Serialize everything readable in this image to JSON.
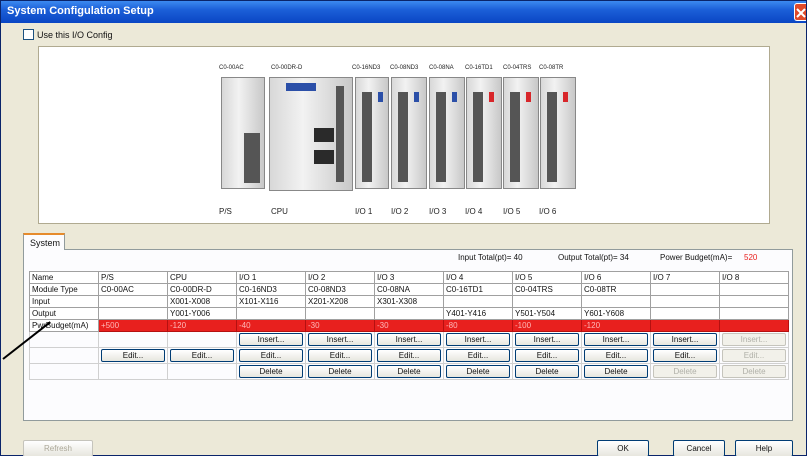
{
  "window": {
    "title": "System Configulation Setup"
  },
  "use_io_config": {
    "label": "Use this I/O Config",
    "checked": false
  },
  "hardware": {
    "module_labels": [
      "C0-00AC",
      "C0-00DR-D",
      "C0-16ND3",
      "C0-08ND3",
      "C0-08NA",
      "C0-16TD1",
      "C0-04TRS",
      "C0-08TR"
    ],
    "slot_labels": [
      "P/S",
      "CPU",
      "I/O 1",
      "I/O 2",
      "I/O 3",
      "I/O 4",
      "I/O 5",
      "I/O 6"
    ]
  },
  "tabs": [
    {
      "label": "System"
    }
  ],
  "totals": {
    "input": "Input Total(pt)= 40",
    "output": "Output Total(pt)= 34",
    "power_label": "Power Budget(mA)=",
    "power_value": "520"
  },
  "grid": {
    "columns": [
      "",
      "P/S",
      "CPU",
      "I/O 1",
      "I/O 2",
      "I/O 3",
      "I/O 4",
      "I/O 5",
      "I/O 6",
      "I/O 7",
      "I/O 8"
    ],
    "rows": [
      {
        "head": "Name",
        "cells": [
          "P/S",
          "CPU",
          "I/O 1",
          "I/O 2",
          "I/O 3",
          "I/O 4",
          "I/O 5",
          "I/O 6",
          "I/O 7",
          "I/O 8"
        ]
      },
      {
        "head": "Module Type",
        "cells": [
          "C0-00AC",
          "C0-00DR-D",
          "C0-16ND3",
          "C0-08ND3",
          "C0-08NA",
          "C0-16TD1",
          "C0-04TRS",
          "C0-08TR",
          "",
          ""
        ]
      },
      {
        "head": "Input",
        "cells": [
          "",
          "X001-X008",
          "X101-X116",
          "X201-X208",
          "X301-X308",
          "",
          "",
          "",
          "",
          ""
        ]
      },
      {
        "head": "Output",
        "cells": [
          "",
          "Y001-Y006",
          "",
          "",
          "",
          "Y401-Y416",
          "Y501-Y504",
          "Y601-Y608",
          "",
          ""
        ]
      },
      {
        "head": "PwrBudget(mA)",
        "cells": [
          "+500",
          "-120",
          "-40",
          "-30",
          "-30",
          "-80",
          "-100",
          "-120",
          "",
          ""
        ]
      }
    ],
    "insert_label": "Insert...",
    "edit_label": "Edit...",
    "delete_label": "Delete"
  },
  "buttons": {
    "refresh": "Refresh",
    "ok": "OK",
    "cancel": "Cancel",
    "help": "Help"
  },
  "colors": {
    "power_row": "#e8201e",
    "power_value": "#e8201e",
    "titlebar": "#1b5fd8"
  }
}
